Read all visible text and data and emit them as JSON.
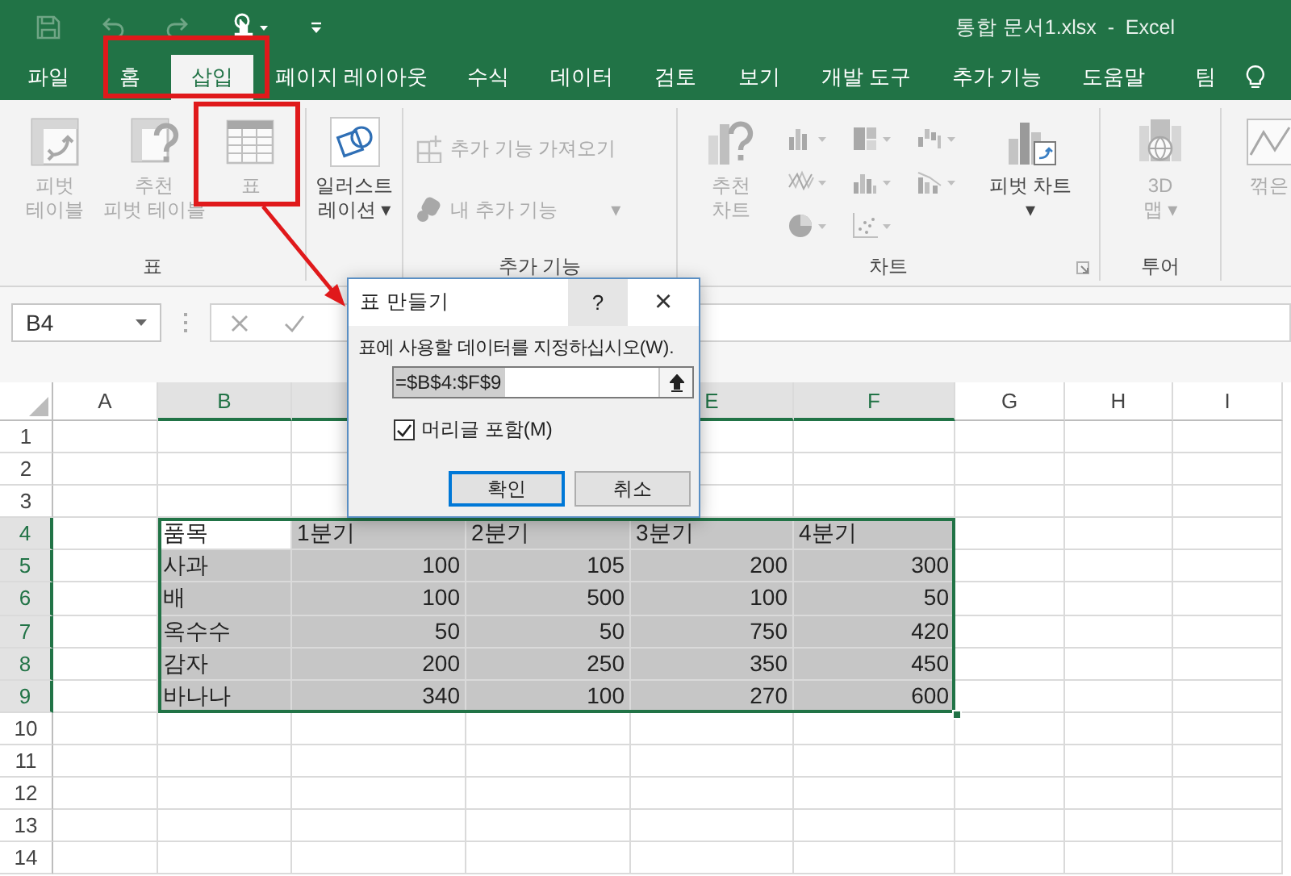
{
  "title_bar": {
    "title": "통합 문서1.xlsx  -  Excel"
  },
  "tabs": [
    {
      "label": "파일",
      "selected": false
    },
    {
      "label": "홈",
      "selected": false
    },
    {
      "label": "삽입",
      "selected": true
    },
    {
      "label": "페이지 레이아웃",
      "selected": false
    },
    {
      "label": "수식",
      "selected": false
    },
    {
      "label": "데이터",
      "selected": false
    },
    {
      "label": "검토",
      "selected": false
    },
    {
      "label": "보기",
      "selected": false
    },
    {
      "label": "개발 도구",
      "selected": false
    },
    {
      "label": "추가 기능",
      "selected": false
    },
    {
      "label": "도움말",
      "selected": false
    },
    {
      "label": "팀",
      "selected": false
    }
  ],
  "ribbon": {
    "groups": [
      {
        "label": "표",
        "items": [
          {
            "kind": "large",
            "label": "피벗\n테이블",
            "disabled": true
          },
          {
            "kind": "large",
            "label": "추천\n피벗 테이블",
            "disabled": true
          },
          {
            "kind": "large",
            "label": "표",
            "disabled": true
          }
        ]
      },
      {
        "items": [
          {
            "kind": "large",
            "label": "일러스트\n레이션 ▾",
            "disabled": false
          }
        ]
      },
      {
        "label": "추가 기능",
        "items": [
          {
            "kind": "small",
            "label": "추가 기능 가져오기",
            "disabled": true
          },
          {
            "kind": "small",
            "label": "내 추가 기능",
            "caret": "▾",
            "disabled": true
          }
        ]
      },
      {
        "label": "차트",
        "launcher": true,
        "items": [
          {
            "kind": "large",
            "label": "추천\n차트",
            "disabled": true
          },
          {
            "kind": "icon_grid",
            "buttons": [
              {
                "disabled": true
              },
              {
                "disabled": true
              },
              {
                "disabled": true
              },
              {
                "disabled": true
              },
              {
                "disabled": true
              },
              {
                "disabled": true
              },
              {
                "disabled": true
              },
              {
                "disabled": true
              }
            ]
          },
          {
            "kind": "large",
            "label": "피벗 차트\n▾",
            "disabled": false
          }
        ]
      },
      {
        "label": "투어",
        "items": [
          {
            "kind": "large",
            "label": "3D\n맵 ▾",
            "disabled": true
          }
        ]
      },
      {
        "items": [
          {
            "kind": "large",
            "label": "꺾은",
            "disabled": true
          }
        ]
      }
    ]
  },
  "formula_bar": {
    "name_box": "B4"
  },
  "sheet": {
    "columns": [
      {
        "label": "A",
        "selected": false
      },
      {
        "label": "B",
        "selected": true
      },
      {
        "selected": true
      },
      {},
      {
        "label": "E",
        "selected": true
      },
      {
        "label": "F",
        "selected": true
      },
      {
        "label": "G",
        "selected": false
      },
      {
        "label": "H",
        "selected": false
      },
      {
        "label": "I",
        "selected": false
      }
    ],
    "rows": [
      {
        "label": "1",
        "selected": false
      },
      {
        "label": "2",
        "selected": false
      },
      {
        "label": "3",
        "selected": false
      },
      {
        "label": "4",
        "selected": true,
        "cells": [
          {
            "text": "품목",
            "selected": false
          },
          {
            "text": "1분기",
            "selected": true
          },
          {
            "text": "2분기",
            "selected": true
          },
          {
            "text": "3분기",
            "selected": true
          },
          {
            "text": "4분기",
            "selected": true
          }
        ]
      },
      {
        "label": "5",
        "selected": true,
        "cells": [
          {
            "text": "사과",
            "selected": true
          },
          {
            "text": "100",
            "selected": true
          },
          {
            "text": "105",
            "selected": true
          },
          {
            "text": "200",
            "selected": true
          },
          {
            "text": "300",
            "selected": true
          }
        ]
      },
      {
        "label": "6",
        "selected": true,
        "cells": [
          {
            "text": "배",
            "selected": true
          },
          {
            "text": "100",
            "selected": true
          },
          {
            "text": "500",
            "selected": true
          },
          {
            "text": "100",
            "selected": true
          },
          {
            "text": "50",
            "selected": true
          }
        ]
      },
      {
        "label": "7",
        "selected": true,
        "cells": [
          {
            "text": "옥수수",
            "selected": true
          },
          {
            "text": "50",
            "selected": true
          },
          {
            "text": "50",
            "selected": true
          },
          {
            "text": "750",
            "selected": true
          },
          {
            "text": "420",
            "selected": true
          }
        ]
      },
      {
        "label": "8",
        "selected": true,
        "cells": [
          {
            "text": "감자",
            "selected": true
          },
          {
            "text": "200",
            "selected": true
          },
          {
            "text": "250",
            "selected": true
          },
          {
            "text": "350",
            "selected": true
          },
          {
            "text": "450",
            "selected": true
          }
        ]
      },
      {
        "label": "9",
        "selected": true,
        "cells": [
          {
            "text": "바나나",
            "selected": true
          },
          {
            "text": "340",
            "selected": true
          },
          {
            "text": "100",
            "selected": true
          },
          {
            "text": "270",
            "selected": true
          },
          {
            "text": "600",
            "selected": true
          }
        ]
      },
      {
        "label": "10",
        "selected": false
      },
      {
        "label": "11",
        "selected": false
      },
      {
        "label": "12",
        "selected": false
      },
      {
        "label": "13",
        "selected": false
      },
      {
        "label": "14",
        "selected": false
      }
    ]
  },
  "dialog": {
    "title": "표 만들기",
    "help": "?",
    "close": "×",
    "prompt": "표에 사용할 데이터를 지정하십시오(W).",
    "range": "=$B$4:$F$9",
    "header_checkbox": {
      "label": "머리글 포함(M)",
      "checked": true
    },
    "buttons": [
      {
        "label": "확인",
        "default": true
      },
      {
        "label": "취소",
        "default": false
      }
    ]
  }
}
